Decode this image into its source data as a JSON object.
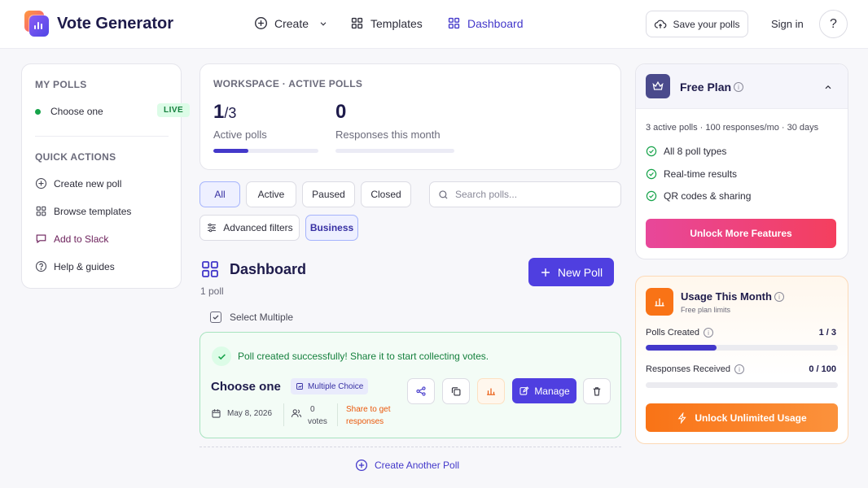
{
  "app": {
    "title": "Vote Generator"
  },
  "nav": {
    "create": "Create",
    "templates": "Templates",
    "dashboard": "Dashboard",
    "save_polls": "Save your polls",
    "sign_in": "Sign in",
    "help": "?"
  },
  "sidebar": {
    "my_polls_heading": "MY POLLS",
    "poll_item": "Choose one",
    "live_badge": "LIVE",
    "quick_actions_heading": "QUICK ACTIONS",
    "actions": [
      "Create new poll",
      "Browse templates",
      "Add to Slack",
      "Help & guides"
    ]
  },
  "workspace": {
    "heading": "WORKSPACE · ACTIVE POLLS",
    "active_count": "1",
    "active_total": "/3",
    "active_label": "Active polls",
    "active_fraction": 0.33,
    "responses_count": "0",
    "responses_label": "Responses this month",
    "responses_fraction": 0
  },
  "filters": {
    "tabs": [
      "All",
      "Active",
      "Paused",
      "Closed"
    ],
    "selected_tab": "All",
    "search_placeholder": "Search polls...",
    "advanced": "Advanced filters",
    "business": "Business"
  },
  "dashboard": {
    "title": "Dashboard",
    "count": "1 poll",
    "new_poll": "New Poll",
    "select_multiple": "Select Multiple"
  },
  "poll": {
    "success_message": "Poll created successfully! Share it to start collecting votes.",
    "name": "Choose one",
    "type": "Multiple Choice",
    "date": "May 8, 2026",
    "votes_count": "0",
    "votes_label": "votes",
    "share_hint_1": "Share to get",
    "share_hint_2": "responses",
    "manage": "Manage"
  },
  "create_another": "Create Another Poll",
  "plan": {
    "title": "Free Plan",
    "summary": "3 active polls · 100 responses/mo · 30 days",
    "features": [
      "All 8 poll types",
      "Real-time results",
      "QR codes & sharing"
    ],
    "unlock": "Unlock More Features"
  },
  "usage": {
    "title": "Usage This Month",
    "subtitle": "Free plan limits",
    "polls_label": "Polls Created",
    "polls_value": "1 / 3",
    "polls_fraction": 0.37,
    "responses_label": "Responses Received",
    "responses_value": "0 / 100",
    "responses_fraction": 0,
    "unlock": "Unlock Unlimited Usage"
  },
  "colors": {
    "brand": "#4f3fe0",
    "success": "#15803d",
    "warning": "#ea580c",
    "pink": "#e8479a"
  }
}
